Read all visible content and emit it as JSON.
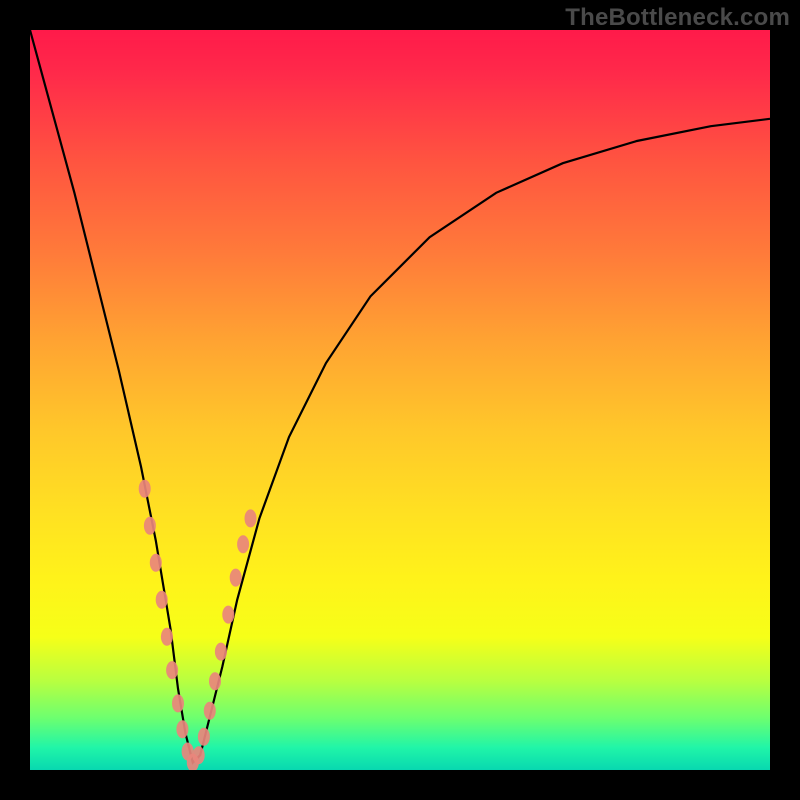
{
  "watermark": "TheBottleneck.com",
  "colors": {
    "frame": "#000000",
    "gradient_stops": [
      {
        "pct": 0,
        "hex": "#ff1a4a"
      },
      {
        "pct": 6,
        "hex": "#ff2a4a"
      },
      {
        "pct": 18,
        "hex": "#ff5540"
      },
      {
        "pct": 30,
        "hex": "#ff7a3a"
      },
      {
        "pct": 42,
        "hex": "#ffa332"
      },
      {
        "pct": 54,
        "hex": "#ffc72a"
      },
      {
        "pct": 65,
        "hex": "#ffe022"
      },
      {
        "pct": 74,
        "hex": "#fff21a"
      },
      {
        "pct": 82,
        "hex": "#f6ff18"
      },
      {
        "pct": 88,
        "hex": "#b8ff40"
      },
      {
        "pct": 93,
        "hex": "#6cff70"
      },
      {
        "pct": 97,
        "hex": "#20f5a8"
      },
      {
        "pct": 100,
        "hex": "#08d8b0"
      }
    ],
    "curve_stroke": "#000000",
    "marker_fill": "#e9857c"
  },
  "chart_data": {
    "type": "line",
    "title": "",
    "xlabel": "",
    "ylabel": "",
    "xlim": [
      0,
      100
    ],
    "ylim": [
      0,
      100
    ],
    "note": "Y values are abstract 'bottleneck' magnitudes read from vertical position (0 = bottom/green, 100 = top/red). Curve minimum near x ≈ 22.",
    "series": [
      {
        "name": "curve",
        "x": [
          0,
          3,
          6,
          9,
          12,
          15,
          17,
          19,
          20,
          21,
          22,
          23,
          24,
          26,
          28,
          31,
          35,
          40,
          46,
          54,
          63,
          72,
          82,
          92,
          100
        ],
        "y": [
          100,
          89,
          78,
          66,
          54,
          41,
          31,
          19,
          11,
          5,
          1,
          2,
          6,
          14,
          23,
          34,
          45,
          55,
          64,
          72,
          78,
          82,
          85,
          87,
          88
        ]
      }
    ],
    "markers": {
      "name": "highlight-dots",
      "x": [
        15.5,
        16.2,
        17.0,
        17.8,
        18.5,
        19.2,
        20.0,
        20.6,
        21.3,
        22.0,
        22.8,
        23.5,
        24.3,
        25.0,
        25.8,
        26.8,
        27.8,
        28.8,
        29.8
      ],
      "y": [
        38.0,
        33.0,
        28.0,
        23.0,
        18.0,
        13.5,
        9.0,
        5.5,
        2.5,
        1.0,
        2.0,
        4.5,
        8.0,
        12.0,
        16.0,
        21.0,
        26.0,
        30.5,
        34.0
      ]
    }
  }
}
